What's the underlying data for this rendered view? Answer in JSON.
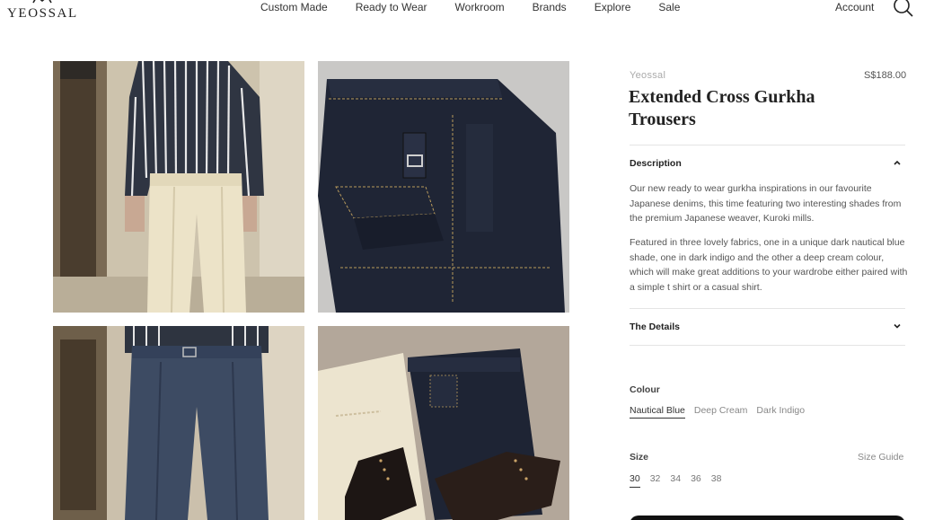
{
  "brand": {
    "logo_text": "YEOSSAL"
  },
  "nav": [
    "Custom Made",
    "Ready to Wear",
    "Workroom",
    "Brands",
    "Explore",
    "Sale"
  ],
  "header": {
    "account_label": "Account",
    "search_icon": "search-icon"
  },
  "gallery": {
    "image1": "model in striped shirt and cream gurkha trousers",
    "image2": "dark denim gurkha trousers folded flat",
    "image3": "model in nautical blue gurkha trousers",
    "image4": "trousers in cream and indigo with leather boots"
  },
  "product": {
    "vendor": "Yeossal",
    "price": "S$188.00",
    "title": "Extended Cross Gurkha Trousers",
    "description_heading": "Description",
    "description_p1": "Our new ready to wear gurkha inspirations in our favourite Japanese denims, this time featuring two interesting shades from the premium Japanese weaver, Kuroki mills.",
    "description_p2": "Featured in three lovely fabrics, one in a unique dark nautical blue shade, one in dark indigo and the other a deep cream colour, which will make great additions to your wardrobe either paired with a simple t shirt or a casual shirt.",
    "details_heading": "The Details",
    "colour_label": "Colour",
    "colours": [
      "Nautical Blue",
      "Deep Cream",
      "Dark Indigo"
    ],
    "selected_colour": "Nautical Blue",
    "size_label": "Size",
    "size_guide_label": "Size Guide",
    "sizes": [
      "30",
      "32",
      "34",
      "36",
      "38"
    ],
    "selected_size": "30"
  },
  "colors": {
    "text": "#222222",
    "muted": "#888888",
    "divider": "#e4e4e4",
    "button": "#111111"
  }
}
